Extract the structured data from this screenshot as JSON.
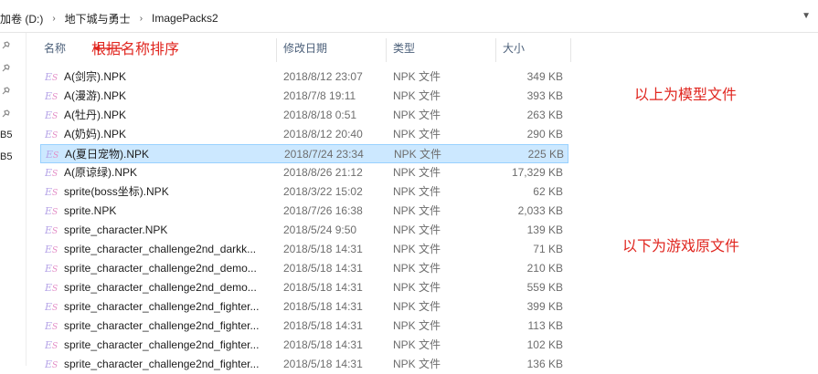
{
  "breadcrumb": {
    "items": [
      "加卷 (D:)",
      "地下城与勇士",
      "ImagePacks2"
    ],
    "separator": "›"
  },
  "left_pane": {
    "labels": [
      "B5",
      "B5"
    ]
  },
  "columns": {
    "name": "名称",
    "date": "修改日期",
    "type": "类型",
    "size": "大小"
  },
  "annotations": {
    "sort_note": "根据名称排序",
    "model_note": "以上为模型文件",
    "original_note": "以下为游戏原文件",
    "color": "#e0261f"
  },
  "file_icon": {
    "name": "npk-file-icon",
    "glyph_main": "E",
    "glyph_sub": "S"
  },
  "files": [
    {
      "name": "A(剑宗).NPK",
      "date": "2018/8/12 23:07",
      "type": "NPK 文件",
      "size": "349 KB"
    },
    {
      "name": "A(漫游).NPK",
      "date": "2018/7/8 19:11",
      "type": "NPK 文件",
      "size": "393 KB"
    },
    {
      "name": "A(牡丹).NPK",
      "date": "2018/8/18 0:51",
      "type": "NPK 文件",
      "size": "263 KB"
    },
    {
      "name": "A(奶妈).NPK",
      "date": "2018/8/12 20:40",
      "type": "NPK 文件",
      "size": "290 KB"
    },
    {
      "name": "A(夏日宠物).NPK",
      "date": "2018/7/24 23:34",
      "type": "NPK 文件",
      "size": "225 KB",
      "selected": true
    },
    {
      "name": "A(原谅绿).NPK",
      "date": "2018/8/26 21:12",
      "type": "NPK 文件",
      "size": "17,329 KB"
    },
    {
      "name": "sprite(boss坐标).NPK",
      "date": "2018/3/22 15:02",
      "type": "NPK 文件",
      "size": "62 KB"
    },
    {
      "name": "sprite.NPK",
      "date": "2018/7/26 16:38",
      "type": "NPK 文件",
      "size": "2,033 KB"
    },
    {
      "name": "sprite_character.NPK",
      "date": "2018/5/24 9:50",
      "type": "NPK 文件",
      "size": "139 KB"
    },
    {
      "name": "sprite_character_challenge2nd_darkk...",
      "date": "2018/5/18 14:31",
      "type": "NPK 文件",
      "size": "71 KB"
    },
    {
      "name": "sprite_character_challenge2nd_demo...",
      "date": "2018/5/18 14:31",
      "type": "NPK 文件",
      "size": "210 KB"
    },
    {
      "name": "sprite_character_challenge2nd_demo...",
      "date": "2018/5/18 14:31",
      "type": "NPK 文件",
      "size": "559 KB"
    },
    {
      "name": "sprite_character_challenge2nd_fighter...",
      "date": "2018/5/18 14:31",
      "type": "NPK 文件",
      "size": "399 KB"
    },
    {
      "name": "sprite_character_challenge2nd_fighter...",
      "date": "2018/5/18 14:31",
      "type": "NPK 文件",
      "size": "113 KB"
    },
    {
      "name": "sprite_character_challenge2nd_fighter...",
      "date": "2018/5/18 14:31",
      "type": "NPK 文件",
      "size": "102 KB"
    },
    {
      "name": "sprite_character_challenge2nd_fighter...",
      "date": "2018/5/18 14:31",
      "type": "NPK 文件",
      "size": "136 KB"
    }
  ]
}
